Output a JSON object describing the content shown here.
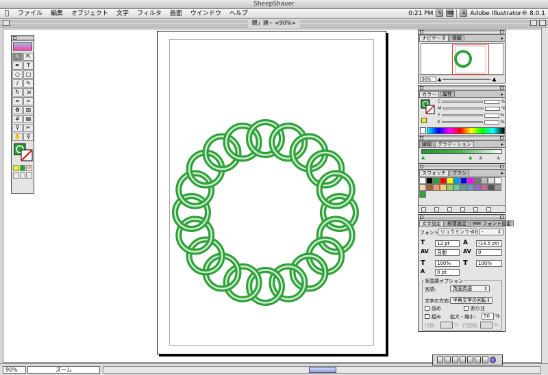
{
  "host": {
    "title": "SheepShaver"
  },
  "menubar": {
    "items": [
      "ファイル",
      "編集",
      "オブジェクト",
      "文字",
      "フィルタ",
      "画面",
      "ウインドウ",
      "ヘルプ"
    ],
    "clock": "0:21 PM",
    "app_name": "Adobe Illustrator® 8.0.1"
  },
  "document": {
    "title": "聰」適~ <90%>",
    "zoom": "90%",
    "status": "ズーム"
  },
  "artwork": {
    "ring_color": "#2fa23a",
    "highlight_color": "#ffffff"
  },
  "navigator": {
    "tabs": [
      "ナビゲータ",
      "情報"
    ],
    "zoom": "90%"
  },
  "color_palette": {
    "tabs": [
      "カラー",
      "属性"
    ],
    "channels": [
      "C",
      "M",
      "Y",
      "K"
    ],
    "unit": "%"
  },
  "gradient_palette": {
    "tabs": [
      "線幅",
      "グラデーション"
    ]
  },
  "swatches": {
    "tabs": [
      "スウォッチ",
      "ブラシ"
    ],
    "colors": [
      "#ffffff",
      "#000000",
      "#2fa23a",
      "#ff0000",
      "#ffff00",
      "#00a0e0",
      "#0000ff",
      "#ff00ff",
      "#777777",
      "#bbbbbb",
      "#e0e0e0",
      "#ffffff",
      "#f5d6b0",
      "#996633",
      "#ff9966",
      "#ffcc66",
      "#99cc66",
      "#66cc99",
      "#669999",
      "#6699cc",
      "#9966cc",
      "#cc6699",
      "#555555",
      "#999999",
      "#2fa23a"
    ]
  },
  "character": {
    "tabs": [
      "文字設定",
      "段落設定",
      "MM フォント設定"
    ],
    "font_label": "フォント:",
    "font_value": "リュウミンライト",
    "style_value": "-",
    "size": "12 pt",
    "leading": "(14.5 pt)",
    "kerning": "自動",
    "tracking": "0",
    "v_scale": "100%",
    "h_scale": "100%",
    "baseline": "0 pt",
    "multilang_title": "多国語オプション",
    "language_label": "言語:",
    "language_value": "英国英語",
    "direction_label": "文字の方向:",
    "direction_value": "半角文字の回転",
    "opt_tsume": "詰め",
    "opt_warichu": "割り注",
    "opt_kumi": "組み",
    "scale_label": "拡大・縮小:",
    "scale_value": "50",
    "pct": "%",
    "row_count_label": "行数:",
    "line_count_label": "行間隔:"
  }
}
